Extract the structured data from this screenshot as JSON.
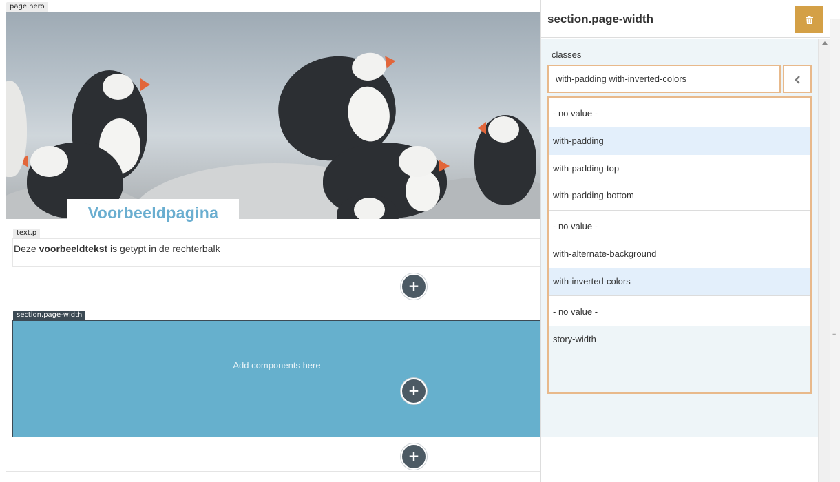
{
  "canvas": {
    "hero_tag": "page.hero",
    "hero_title": "Voorbeeldpagina",
    "text_tag": "text.p",
    "text_parts": {
      "before": "Deze ",
      "bold": "voorbeeldtekst",
      "after": " is getypt in de rechterbalk"
    },
    "section_tag": "section.page-width",
    "section_hint": "Add components here",
    "add_icon": "+"
  },
  "panel": {
    "title": "section.page-width",
    "delete_icon": "trash-icon",
    "classes_label": "classes",
    "classes_value": "with-padding with-inverted-colors",
    "toggle_icon": "chevron-left-icon",
    "option_groups": [
      [
        {
          "label": "- no value -",
          "selected": false
        },
        {
          "label": "with-padding",
          "selected": true
        },
        {
          "label": "with-padding-top",
          "selected": false
        },
        {
          "label": "with-padding-bottom",
          "selected": false
        }
      ],
      [
        {
          "label": "- no value -",
          "selected": false
        },
        {
          "label": "with-alternate-background",
          "selected": false
        },
        {
          "label": "with-inverted-colors",
          "selected": true
        }
      ],
      [
        {
          "label": "- no value -",
          "selected": false
        },
        {
          "label": "story-width",
          "selected": false
        }
      ]
    ]
  },
  "colors": {
    "accent_blue": "#66b0cd",
    "title_blue": "#6aaed0",
    "delete_orange": "#d4a046",
    "highlight_border": "#e8b98b",
    "selected_bg": "#e3effb",
    "button_dark": "#4c5a64"
  }
}
